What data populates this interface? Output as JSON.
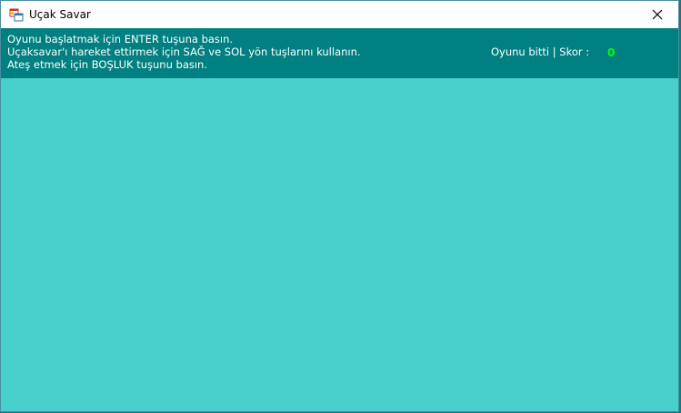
{
  "window": {
    "title": "Uçak Savar"
  },
  "instructions": [
    "Oyunu başlatmak için ENTER tuşuna basın.",
    "Uçaksavar'ı hareket ettirmek için SAĞ ve SOL yön tuşlarını kullanın.",
    "Ateş etmek için BOŞLUK tuşunu basın."
  ],
  "status": {
    "game_state": "Oyunu bitti |",
    "score_label": "Skor :",
    "score_value": "0"
  },
  "colors": {
    "panel": "#008080",
    "game_area": "#48d1cc",
    "score_value": "#00ff00"
  },
  "icons": {
    "app": "app-window-icon",
    "close": "close-icon"
  }
}
